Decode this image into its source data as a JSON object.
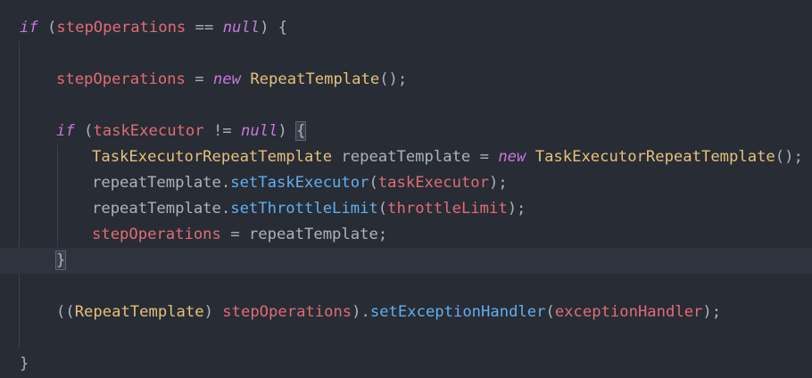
{
  "editor": {
    "theme": {
      "background": "#282c34",
      "current_line": "#2f333d",
      "keyword": "#c678dd",
      "variable": "#e06c75",
      "type": "#e5c07b",
      "function": "#61afef",
      "plain": "#abb2bf"
    },
    "lines": [
      {
        "indent": 0,
        "tokens": [
          {
            "t": "if",
            "c": "kw"
          },
          {
            "t": " (",
            "c": "plain"
          },
          {
            "t": "stepOperations",
            "c": "var"
          },
          {
            "t": " == ",
            "c": "plain"
          },
          {
            "t": "null",
            "c": "kw"
          },
          {
            "t": ") {",
            "c": "plain"
          }
        ]
      },
      {
        "indent": 0,
        "tokens": []
      },
      {
        "indent": 1,
        "tokens": [
          {
            "t": "stepOperations",
            "c": "var"
          },
          {
            "t": " = ",
            "c": "plain"
          },
          {
            "t": "new",
            "c": "kw"
          },
          {
            "t": " ",
            "c": "plain"
          },
          {
            "t": "RepeatTemplate",
            "c": "type"
          },
          {
            "t": "();",
            "c": "plain"
          }
        ]
      },
      {
        "indent": 0,
        "tokens": []
      },
      {
        "indent": 1,
        "tokens": [
          {
            "t": "if",
            "c": "kw"
          },
          {
            "t": " (",
            "c": "plain"
          },
          {
            "t": "taskExecutor",
            "c": "var"
          },
          {
            "t": " != ",
            "c": "plain"
          },
          {
            "t": "null",
            "c": "kw"
          },
          {
            "t": ") ",
            "c": "plain"
          },
          {
            "t": "{",
            "c": "plain",
            "match": true
          }
        ]
      },
      {
        "indent": 2,
        "tokens": [
          {
            "t": "TaskExecutorRepeatTemplate",
            "c": "type"
          },
          {
            "t": " repeatTemplate = ",
            "c": "plain"
          },
          {
            "t": "new",
            "c": "kw"
          },
          {
            "t": " ",
            "c": "plain"
          },
          {
            "t": "TaskExecutorRepeatTemplate",
            "c": "type"
          },
          {
            "t": "();",
            "c": "plain"
          }
        ]
      },
      {
        "indent": 2,
        "tokens": [
          {
            "t": "repeatTemplate.",
            "c": "plain"
          },
          {
            "t": "setTaskExecutor",
            "c": "fn"
          },
          {
            "t": "(",
            "c": "plain"
          },
          {
            "t": "taskExecutor",
            "c": "var"
          },
          {
            "t": ");",
            "c": "plain"
          }
        ]
      },
      {
        "indent": 2,
        "tokens": [
          {
            "t": "repeatTemplate.",
            "c": "plain"
          },
          {
            "t": "setThrottleLimit",
            "c": "fn"
          },
          {
            "t": "(",
            "c": "plain"
          },
          {
            "t": "throttleLimit",
            "c": "var"
          },
          {
            "t": ");",
            "c": "plain"
          }
        ]
      },
      {
        "indent": 2,
        "tokens": [
          {
            "t": "stepOperations",
            "c": "var"
          },
          {
            "t": " = repeatTemplate;",
            "c": "plain"
          }
        ]
      },
      {
        "indent": 1,
        "current": true,
        "tokens": [
          {
            "t": "}",
            "c": "plain",
            "match": true
          }
        ]
      },
      {
        "indent": 0,
        "tokens": []
      },
      {
        "indent": 1,
        "tokens": [
          {
            "t": "((",
            "c": "plain"
          },
          {
            "t": "RepeatTemplate",
            "c": "type"
          },
          {
            "t": ") ",
            "c": "plain"
          },
          {
            "t": "stepOperations",
            "c": "var"
          },
          {
            "t": ").",
            "c": "plain"
          },
          {
            "t": "setExceptionHandler",
            "c": "fn"
          },
          {
            "t": "(",
            "c": "plain"
          },
          {
            "t": "exceptionHandler",
            "c": "var"
          },
          {
            "t": ");",
            "c": "plain"
          }
        ]
      },
      {
        "indent": 0,
        "tokens": []
      },
      {
        "indent": 0,
        "tokens": [
          {
            "t": "}",
            "c": "plain"
          }
        ]
      }
    ]
  }
}
